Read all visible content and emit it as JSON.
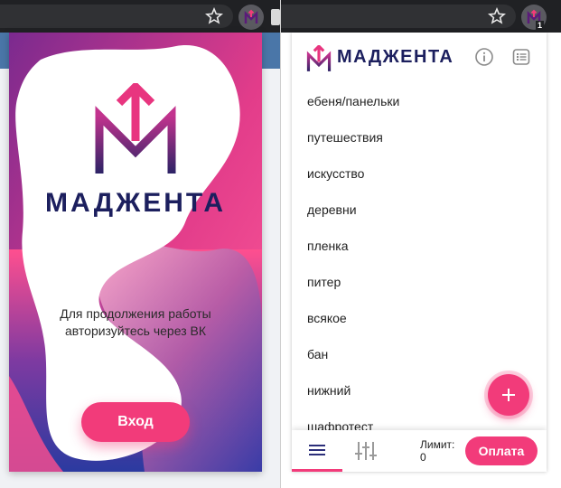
{
  "brand": {
    "name": "МАДЖЕНТА",
    "accent": "#f23b7a",
    "navy": "#1c1f5e"
  },
  "login_screen": {
    "auth_message_line1": "Для продолжения работы",
    "auth_message_line2": "авторизуйтесь через ВК",
    "login_button": "Вход"
  },
  "toolbar": {
    "star_icon": "star-icon",
    "extension_icon": "magenta-extension-icon",
    "badge": "1"
  },
  "header": {
    "info_icon": "info-icon",
    "list_icon": "list-icon"
  },
  "tags": [
    "ебеня/панельки",
    "путешествия",
    "искусство",
    "деревни",
    "пленка",
    "питер",
    "всякое",
    "бан",
    "нижний",
    "шафротест"
  ],
  "fab": {
    "icon": "plus-icon"
  },
  "bottom_bar": {
    "limit_label": "Лимит:",
    "limit_value": "0",
    "pay_button": "Оплата"
  }
}
